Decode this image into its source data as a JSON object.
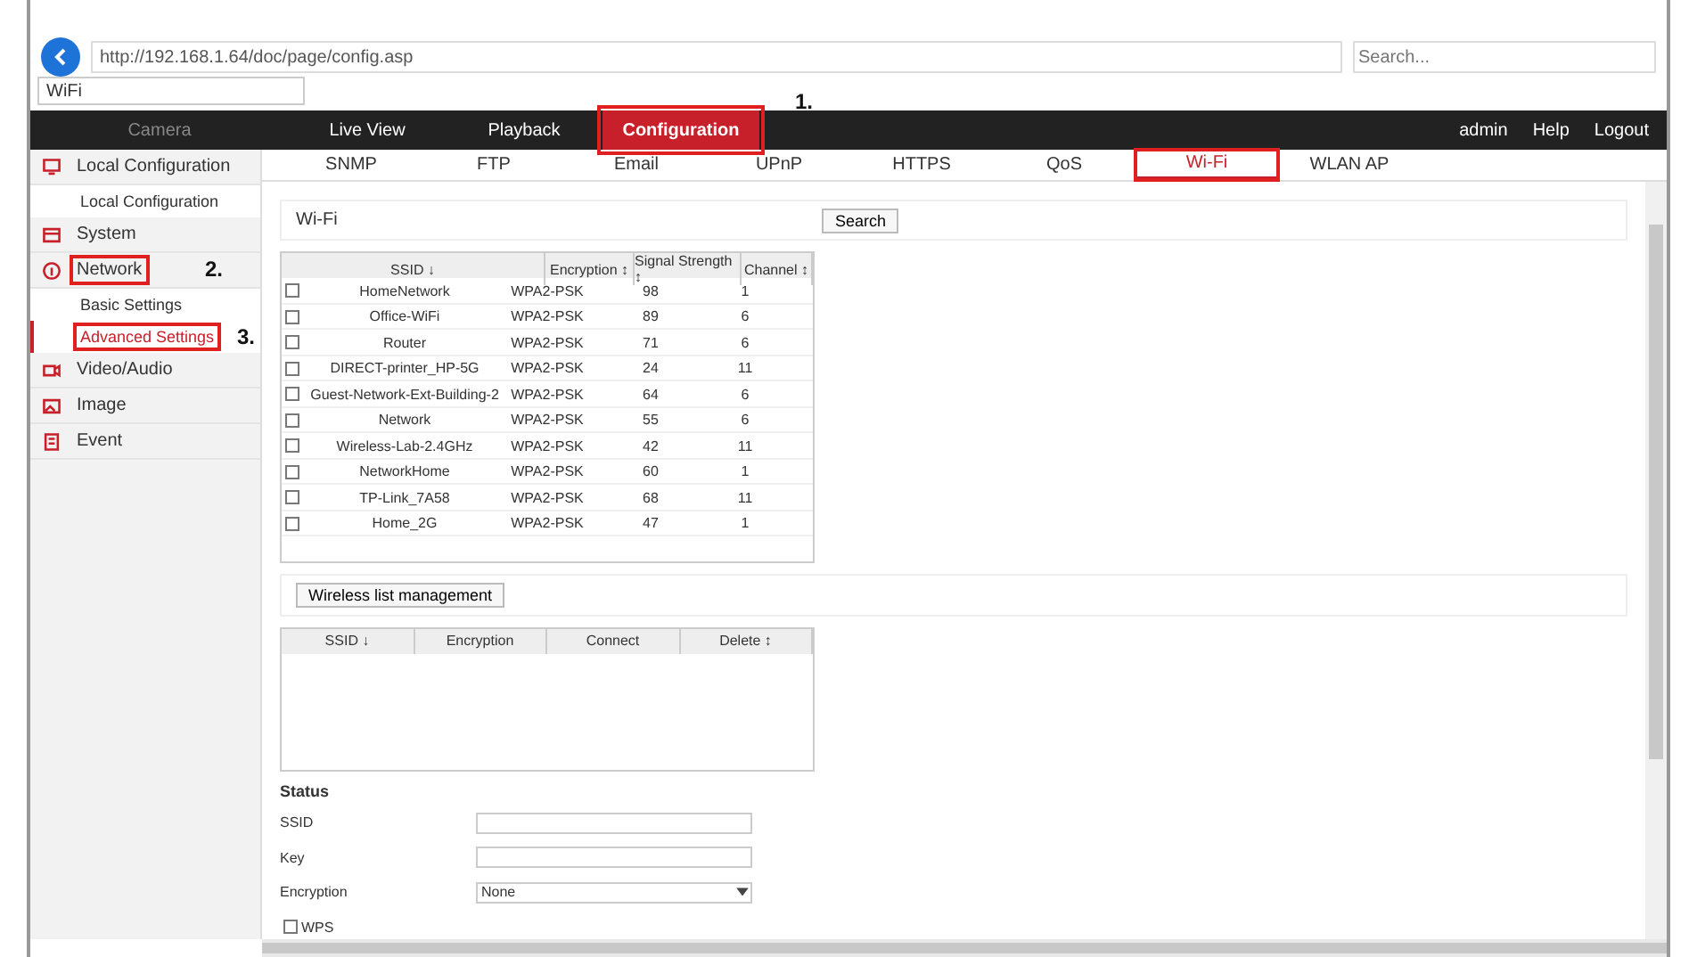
{
  "browser": {
    "url": "http://192.168.1.64/doc/page/config.asp",
    "search_placeholder": "Search...",
    "tab_title": "WiFi"
  },
  "top_nav": {
    "brand": "Camera",
    "items": [
      {
        "label": "Live View",
        "selected": false,
        "highlighted": false
      },
      {
        "label": "Playback",
        "selected": false,
        "highlighted": false
      },
      {
        "label": "Configuration",
        "selected": true,
        "highlighted": true,
        "annotation": "1."
      }
    ],
    "user_links": [
      "admin",
      "Help",
      "Logout"
    ]
  },
  "sidebar": [
    {
      "label": "Local Configuration",
      "highlighted": false,
      "children": [
        {
          "label": "Local Configuration",
          "selected": false,
          "highlighted": false
        }
      ]
    },
    {
      "label": "System",
      "highlighted": false
    },
    {
      "label": "Network",
      "highlighted": true,
      "annotation": "2.",
      "children": [
        {
          "label": "Basic Settings",
          "selected": false,
          "highlighted": false
        },
        {
          "label": "Advanced Settings",
          "selected": true,
          "highlighted": true,
          "annotation": "3."
        }
      ]
    },
    {
      "label": "Video/Audio",
      "highlighted": false
    },
    {
      "label": "Image",
      "highlighted": false
    },
    {
      "label": "Event",
      "highlighted": false
    }
  ],
  "tabs": [
    {
      "label": "SNMP",
      "selected": false,
      "highlighted": false
    },
    {
      "label": "FTP",
      "selected": false,
      "highlighted": false
    },
    {
      "label": "Email",
      "selected": false,
      "highlighted": false
    },
    {
      "label": "UPnP",
      "selected": false,
      "highlighted": false
    },
    {
      "label": "HTTPS",
      "selected": false,
      "highlighted": false
    },
    {
      "label": "QoS",
      "selected": false,
      "highlighted": false
    },
    {
      "label": "Wi-Fi",
      "selected": true,
      "highlighted": true
    },
    {
      "label": "WLAN AP",
      "selected": false,
      "highlighted": false
    }
  ],
  "wifi": {
    "label": "Wi-Fi",
    "search_button": "Search",
    "columns": [
      "SSID ↓",
      "Encryption ↕",
      "Signal Strength ↕",
      "Channel ↕"
    ],
    "rows": [
      {
        "checked": false,
        "ssid": "HomeNetwork",
        "encryption": "WPA2-PSK",
        "signal": "98",
        "channel": "1"
      },
      {
        "checked": false,
        "ssid": "Office-WiFi",
        "encryption": "WPA2-PSK",
        "signal": "89",
        "channel": "6"
      },
      {
        "checked": false,
        "ssid": "Router",
        "encryption": "WPA2-PSK",
        "signal": "71",
        "channel": "6"
      },
      {
        "checked": false,
        "ssid": "DIRECT-printer_HP-5G",
        "encryption": "WPA2-PSK",
        "signal": "24",
        "channel": "11"
      },
      {
        "checked": false,
        "ssid": "Guest-Network-Ext-Building-2",
        "encryption": "WPA2-PSK",
        "signal": "64",
        "channel": "6"
      },
      {
        "checked": false,
        "ssid": "Network",
        "encryption": "WPA2-PSK",
        "signal": "55",
        "channel": "6"
      },
      {
        "checked": false,
        "ssid": "Wireless-Lab-2.4GHz",
        "encryption": "WPA2-PSK",
        "signal": "42",
        "channel": "11"
      },
      {
        "checked": false,
        "ssid": "NetworkHome",
        "encryption": "WPA2-PSK",
        "signal": "60",
        "channel": "1"
      },
      {
        "checked": false,
        "ssid": "TP-Link_7A58",
        "encryption": "WPA2-PSK",
        "signal": "68",
        "channel": "11"
      },
      {
        "checked": false,
        "ssid": "Home_2G",
        "encryption": "WPA2-PSK",
        "signal": "47",
        "channel": "1"
      }
    ]
  },
  "list_button": "Wireless list management",
  "saved_list": {
    "columns": [
      "SSID ↓",
      "Encryption",
      "Connect",
      "Delete ↕"
    ]
  },
  "form": {
    "title": "Status",
    "fields": [
      {
        "label": "SSID",
        "kind": "input"
      },
      {
        "label": "Key",
        "kind": "input"
      },
      {
        "label": "Encryption",
        "kind": "select",
        "value": "None"
      }
    ],
    "wps": {
      "label": "WPS",
      "checked": false
    }
  }
}
